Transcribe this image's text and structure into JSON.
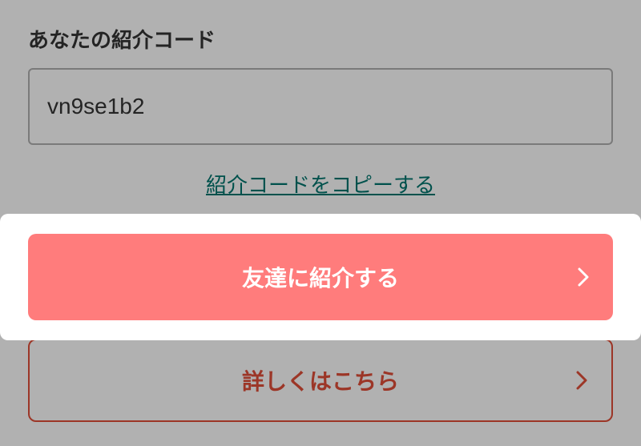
{
  "referral": {
    "label": "あなたの紹介コード",
    "code": "vn9se1b2",
    "copy_link_label": "紹介コードをコピーする"
  },
  "buttons": {
    "primary_label": "友達に紹介する",
    "secondary_label": "詳しくはこちら"
  }
}
